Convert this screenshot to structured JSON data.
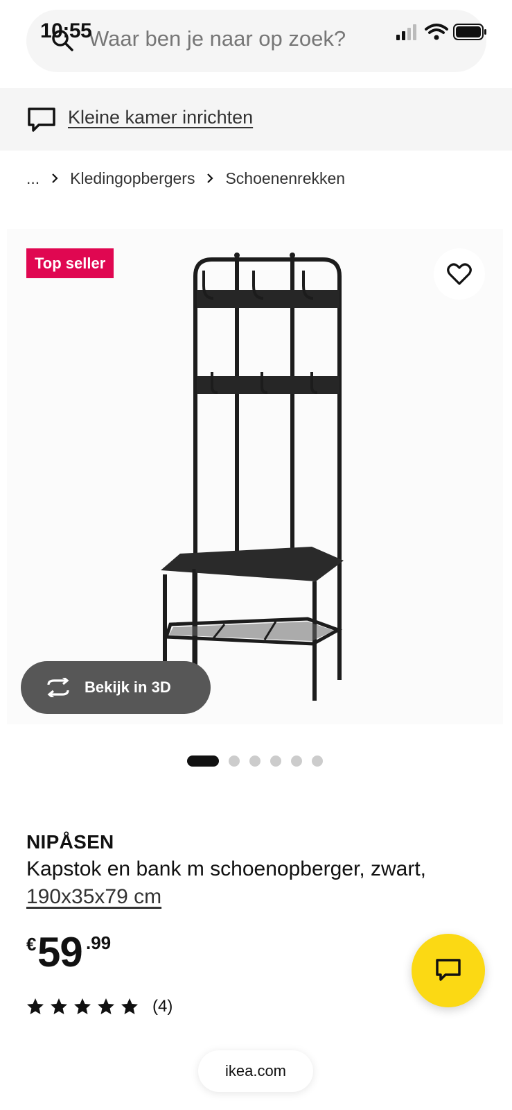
{
  "status_bar": {
    "time": "10:55",
    "icons": [
      "signal-icon",
      "wifi-icon",
      "battery-icon"
    ]
  },
  "search": {
    "placeholder": "Waar ben je naar op zoek?",
    "icon": "search-icon"
  },
  "banner": {
    "icon": "chat-bubble-icon",
    "link_label": "Kleine kamer inrichten"
  },
  "breadcrumb": {
    "items": [
      "...",
      "Kledingopbergers",
      "Schoenenrekken"
    ]
  },
  "gallery": {
    "badge": "Top seller",
    "favorite_icon": "heart-icon",
    "view3d_label": "Bekijk in 3D",
    "view3d_icon": "rotate-icon",
    "dots_total": 6,
    "active_dot": 1
  },
  "product": {
    "name": "NIPÅSEN",
    "description": "Kapstok en bank m schoenopberger, zwart,",
    "dimensions": "190x35x79 cm",
    "price": {
      "currency": "€",
      "integer": "59",
      "decimal": ".99"
    },
    "rating": {
      "stars": 5,
      "count": "(4)"
    }
  },
  "chat_button": {
    "icon": "chat-icon",
    "color": "#fbd914"
  },
  "browser": {
    "url": "ikea.com"
  },
  "colors": {
    "badge": "#e00751",
    "view3d": "#575757",
    "text": "#111111"
  }
}
